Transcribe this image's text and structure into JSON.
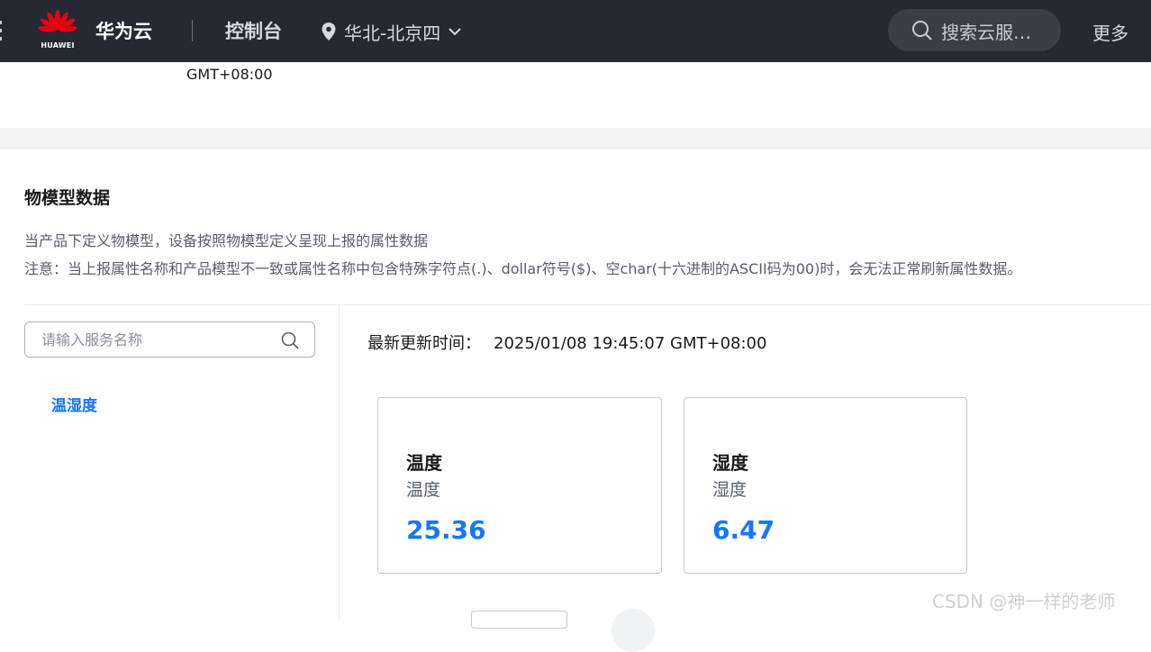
{
  "header": {
    "logo_text": "HUAWEI",
    "brand": "华为云",
    "console": "控制台",
    "region": "华北-北京四",
    "search_placeholder": "搜索云服…",
    "more": "更多"
  },
  "timezone_top": "GMT+08:00",
  "section": {
    "title": "物模型数据",
    "desc1": "当产品下定义物模型，设备按照物模型定义呈现上报的属性数据",
    "desc2": "注意：当上报属性名称和产品模型不一致或属性名称中包含特殊字符点(.)、dollar符号($)、空char(十六进制的ASCII码为00)时，会无法正常刷新属性数据。"
  },
  "service_search": {
    "placeholder": "请输入服务名称"
  },
  "services": [
    {
      "label": "温湿度"
    }
  ],
  "update": {
    "label": "最新更新时间：",
    "value": "2025/01/08 19:45:07 GMT+08:00"
  },
  "cards": [
    {
      "title": "温度",
      "subtitle": "温度",
      "value": "25.36"
    },
    {
      "title": "湿度",
      "subtitle": "湿度",
      "value": "6.47"
    }
  ],
  "watermark": "CSDN @神一样的老师",
  "colors": {
    "topbar": "#252933",
    "accent": "#1476ff",
    "logo_red": "#e60012"
  }
}
